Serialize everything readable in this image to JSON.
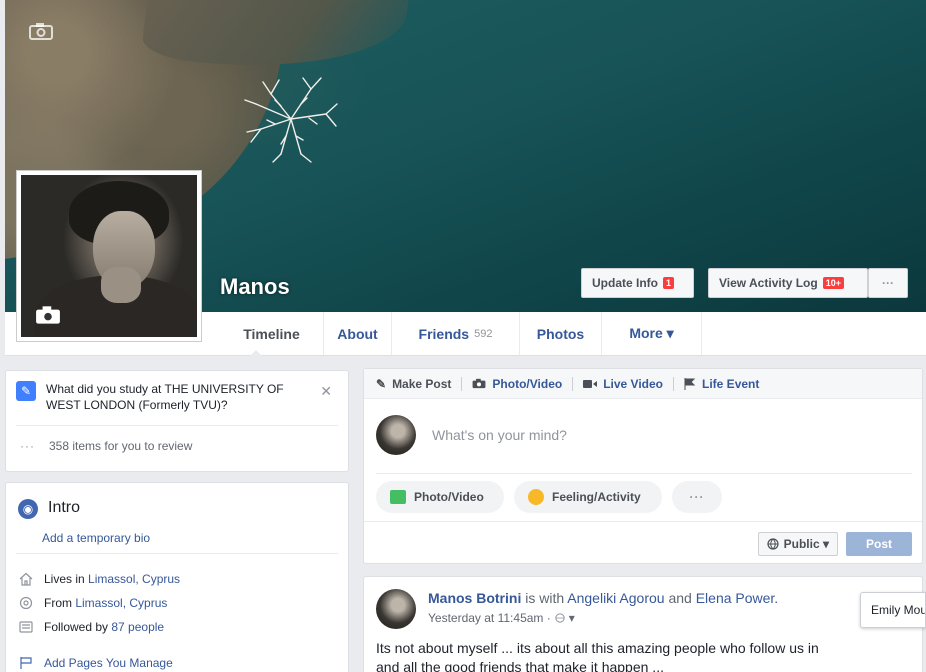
{
  "profile": {
    "name": "Manos"
  },
  "cover_buttons": {
    "update_info": "Update Info",
    "update_info_badge": "1",
    "activity_log": "View Activity Log",
    "activity_log_badge": "10+",
    "more": "···"
  },
  "tabs": [
    {
      "label": "Timeline"
    },
    {
      "label": "About"
    },
    {
      "label": "Friends",
      "count": "592"
    },
    {
      "label": "Photos"
    },
    {
      "label": "More ▾"
    }
  ],
  "study_prompt": {
    "question": "What did you study at THE UNIVERSITY OF WEST LONDON (Formerly TVU)?",
    "close": "✕",
    "review_dots": "···",
    "review_text": "358 items for you to review"
  },
  "intro": {
    "title": "Intro",
    "temp_bio": "Add a temporary bio",
    "lives_prefix": "Lives in",
    "lives_link": "Limassol, Cyprus",
    "from_prefix": "From",
    "from_link": "Limassol, Cyprus",
    "followed_prefix": "Followed by",
    "followed_link": "87 people",
    "pages_manage": "Add Pages You Manage"
  },
  "composer": {
    "tabs": [
      "Make Post",
      "Photo/Video",
      "Live Video",
      "Life Event"
    ],
    "placeholder": "What's on your mind?",
    "photo_video": "Photo/Video",
    "feeling": "Feeling/Activity",
    "more": "···",
    "privacy": "Public ▾",
    "post": "Post"
  },
  "post": {
    "author": "Manos Botrini",
    "with_text": "is with",
    "tag1": "Angeliki Agorou",
    "and_text": "and",
    "tag2": "Elena Power.",
    "timestamp": "Yesterday at 11:45am ·",
    "text_line1": "Its not about myself ... its about all this amazing people who follow us in",
    "text_line2": "and all the good friends that make it happen ..."
  },
  "chat": {
    "name": "Emily Mou"
  },
  "colors": {
    "link": "#365899",
    "brand": "#4267b2",
    "badge": "#fa3e3e",
    "post_button": "#9cb4d8"
  }
}
